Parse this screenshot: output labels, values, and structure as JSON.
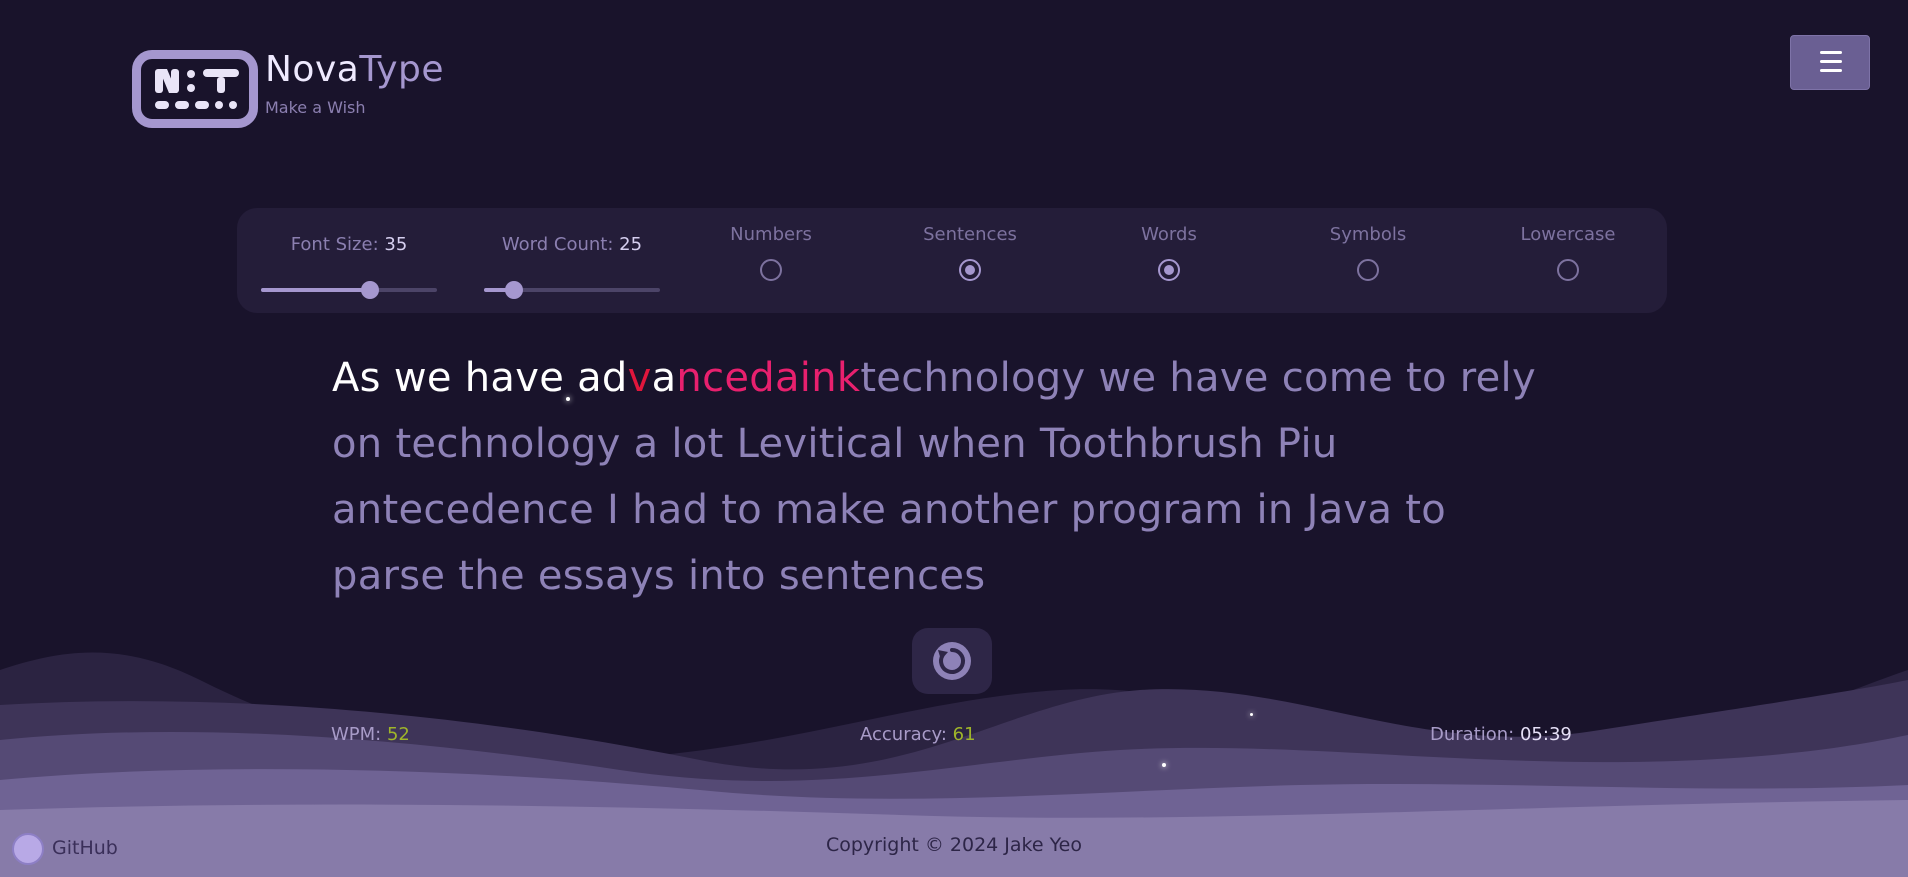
{
  "header": {
    "brand_first": "Nova",
    "brand_second": "Type",
    "tagline": "Make a Wish",
    "menu_icon": "hamburger-icon"
  },
  "settings": {
    "font_size": {
      "label": "Font Size:",
      "value": "35",
      "fraction": 0.62
    },
    "word_count": {
      "label": "Word Count:",
      "value": "25",
      "fraction": 0.17
    },
    "options": [
      {
        "label": "Numbers",
        "checked": false
      },
      {
        "label": "Sentences",
        "checked": true
      },
      {
        "label": "Words",
        "checked": true
      },
      {
        "label": "Symbols",
        "checked": false
      },
      {
        "label": "Lowercase",
        "checked": false
      }
    ]
  },
  "typing": {
    "typed": "As we have ad",
    "wrong_1": "v",
    "typed_2": "a",
    "wrong_2": "ncedaink",
    "remaining_line1": "technology we have come to rely",
    "line2": "on technology a lot Levitical when Toothbrush Piu",
    "line3": "antecedence I had to make another program in Java to",
    "line4": "parse the essays into sentences"
  },
  "restart": {
    "icon": "restart-icon"
  },
  "stats": {
    "wpm_label": "WPM:",
    "wpm": "52",
    "accuracy_label": "Accuracy:",
    "accuracy": "61",
    "duration_label": "Duration:",
    "duration": "05:39"
  },
  "footer": {
    "github_label": "GitHub",
    "copyright": "Copyright © 2024 Jake Yeo"
  },
  "colors": {
    "background": "#19132b",
    "accent": "#a597cf",
    "error": "#e0163c",
    "stat_value": "#9fb52a"
  }
}
